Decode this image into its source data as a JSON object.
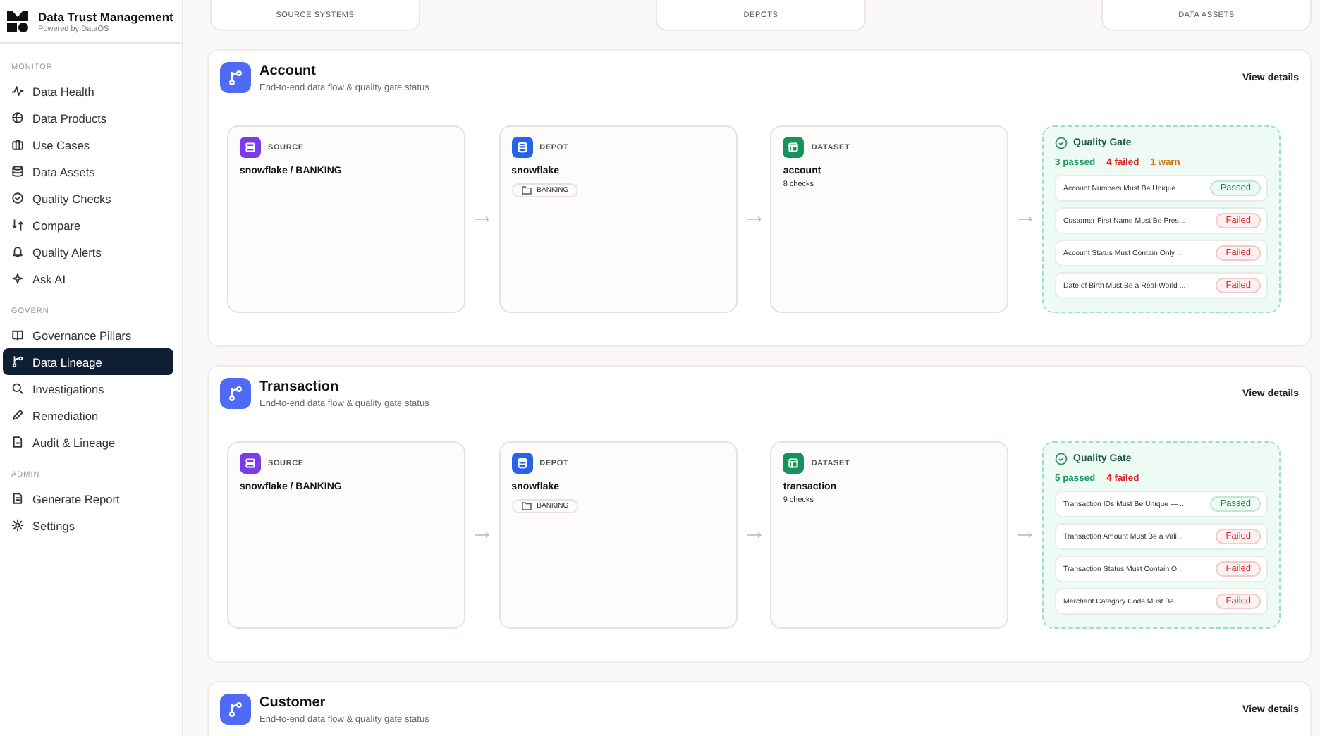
{
  "sidebar": {
    "brand": {
      "title": "Data Trust Management",
      "subtitle": "Powered by DataOS"
    },
    "groups": [
      {
        "label": "MONITOR",
        "items": [
          {
            "label": "Data Health",
            "selected": false
          },
          {
            "label": "Data Products",
            "selected": false
          },
          {
            "label": "Use Cases",
            "selected": false
          },
          {
            "label": "Data Assets",
            "selected": false
          },
          {
            "label": "Quality Checks",
            "selected": false
          },
          {
            "label": "Compare",
            "selected": false
          },
          {
            "label": "Quality Alerts",
            "selected": false
          },
          {
            "label": "Ask AI",
            "selected": false
          }
        ]
      },
      {
        "label": "GOVERN",
        "items": [
          {
            "label": "Governance Pillars",
            "selected": false
          },
          {
            "label": "Data Lineage",
            "selected": true
          },
          {
            "label": "Investigations",
            "selected": false
          },
          {
            "label": "Remediation",
            "selected": false
          },
          {
            "label": "Audit & Lineage",
            "selected": false
          }
        ]
      },
      {
        "label": "ADMIN",
        "items": [
          {
            "label": "Generate Report",
            "selected": false
          },
          {
            "label": "Settings",
            "selected": false
          }
        ]
      }
    ]
  },
  "summary_cards": [
    {
      "label": "SOURCE SYSTEMS"
    },
    {
      "label": "DEPOTS"
    },
    {
      "label": "DATA ASSETS"
    }
  ],
  "sections": [
    {
      "title": "Account",
      "subtitle": "End-to-end data flow & quality gate status",
      "action": "View details",
      "nodes": [
        {
          "kind": "source",
          "type": "SOURCE",
          "name": "snowflake / BANKING"
        },
        {
          "kind": "depot",
          "type": "DEPOT",
          "name": "snowflake",
          "tag": "BANKING"
        },
        {
          "kind": "dataset",
          "type": "DATASET",
          "name": "account",
          "detail": "8 checks"
        }
      ],
      "gate": {
        "title": "Quality Gate",
        "counts": [
          {
            "kind": "passed",
            "text": "3 passed"
          },
          {
            "kind": "failed",
            "text": "4 failed"
          },
          {
            "kind": "warn",
            "text": "1 warn"
          }
        ],
        "checks": [
          {
            "name": "Account Numbers Must Be Unique ...",
            "kind": "passed",
            "status": "Passed"
          },
          {
            "name": "Customer First Name Must Be Pres...",
            "kind": "failed",
            "status": "Failed"
          },
          {
            "name": "Account Status Must Contain Only ...",
            "kind": "failed",
            "status": "Failed"
          },
          {
            "name": "Date of Birth Must Be a Real-World ...",
            "kind": "failed",
            "status": "Failed"
          }
        ]
      }
    },
    {
      "title": "Transaction",
      "subtitle": "End-to-end data flow & quality gate status",
      "action": "View details",
      "nodes": [
        {
          "kind": "source",
          "type": "SOURCE",
          "name": "snowflake / BANKING"
        },
        {
          "kind": "depot",
          "type": "DEPOT",
          "name": "snowflake",
          "tag": "BANKING"
        },
        {
          "kind": "dataset",
          "type": "DATASET",
          "name": "transaction",
          "detail": "9 checks"
        }
      ],
      "gate": {
        "title": "Quality Gate",
        "counts": [
          {
            "kind": "passed",
            "text": "5 passed"
          },
          {
            "kind": "failed",
            "text": "4 failed"
          }
        ],
        "checks": [
          {
            "name": "Transaction IDs Must Be Unique — ...",
            "kind": "passed",
            "status": "Passed"
          },
          {
            "name": "Transaction Amount Must Be a Vali...",
            "kind": "failed",
            "status": "Failed"
          },
          {
            "name": "Transaction Status Must Contain O...",
            "kind": "failed",
            "status": "Failed"
          },
          {
            "name": "Merchant Category Code Must Be ...",
            "kind": "failed",
            "status": "Failed"
          }
        ]
      }
    },
    {
      "title": "Customer",
      "subtitle": "End-to-end data flow & quality gate status",
      "action": "View details"
    }
  ]
}
